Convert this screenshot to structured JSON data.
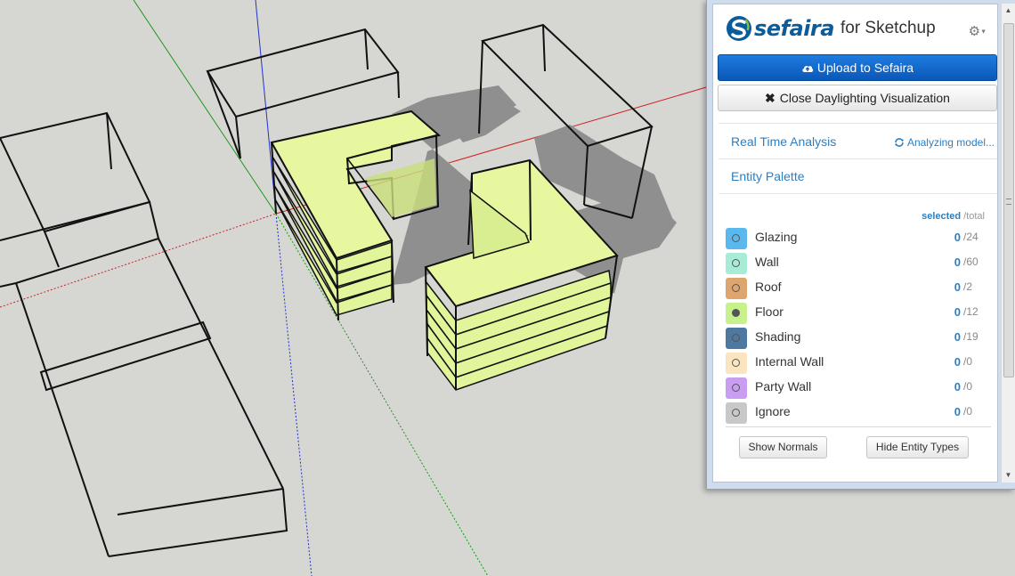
{
  "panel": {
    "brand": {
      "name": "sefaira",
      "suffix": "for Sketchup"
    },
    "settings_icon": "gear-icon",
    "upload_button": {
      "icon": "cloud-upload-icon",
      "label": "Upload to Sefaira"
    },
    "close_button": {
      "icon": "close-icon",
      "glyph": "✖",
      "label": "Close Daylighting Visualization"
    },
    "real_time": {
      "title": "Real Time Analysis",
      "status_icon": "refresh-icon",
      "status": "Analyzing model..."
    },
    "palette": {
      "title": "Entity Palette",
      "selected_label": "selected",
      "total_label": "/total",
      "entities": [
        {
          "name": "Glazing",
          "selected": "0",
          "total": "/24",
          "color": "#5bb8ee",
          "dot": "open"
        },
        {
          "name": "Wall",
          "selected": "0",
          "total": "/60",
          "color": "#a8ecd8",
          "dot": "open"
        },
        {
          "name": "Roof",
          "selected": "0",
          "total": "/2",
          "color": "#dfa56e",
          "dot": "open"
        },
        {
          "name": "Floor",
          "selected": "0",
          "total": "/12",
          "color": "#c8f08c",
          "dot": "filled"
        },
        {
          "name": "Shading",
          "selected": "0",
          "total": "/19",
          "color": "#4e78a0",
          "dot": "open"
        },
        {
          "name": "Internal Wall",
          "selected": "0",
          "total": "/0",
          "color": "#fae5c0",
          "dot": "open"
        },
        {
          "name": "Party Wall",
          "selected": "0",
          "total": "/0",
          "color": "#c99df2",
          "dot": "open"
        },
        {
          "name": "Ignore",
          "selected": "0",
          "total": "/0",
          "color": "#c8c8c8",
          "dot": "open"
        }
      ],
      "show_normals": "Show Normals",
      "hide_entity_types": "Hide Entity Types"
    }
  },
  "colors": {
    "accent": "#2a7fc4",
    "upload_button": "#0a57b8",
    "viewport_background": "#d6d6d3",
    "floor_highlight": "#e8f7a0"
  }
}
